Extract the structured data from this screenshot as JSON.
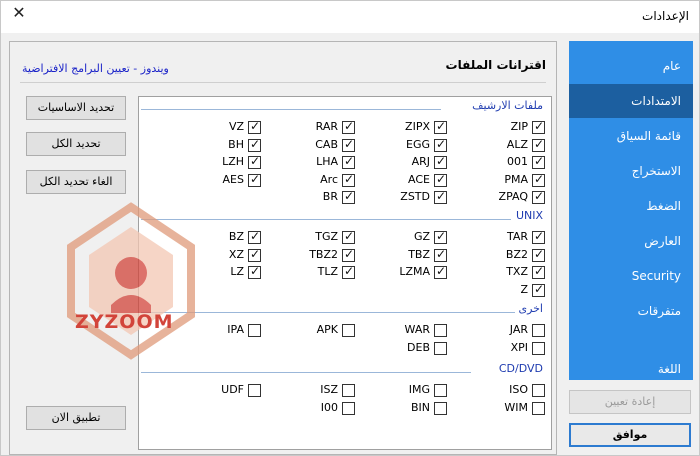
{
  "window": {
    "title": "الإعدادات",
    "close_glyph": "✕"
  },
  "sidebar": {
    "items": [
      {
        "label": "عام"
      },
      {
        "label": "الامتدادات",
        "active": true
      },
      {
        "label": "قائمة السياق"
      },
      {
        "label": "الاستخراج"
      },
      {
        "label": "الضغط"
      },
      {
        "label": "العارض"
      },
      {
        "label": "Security"
      },
      {
        "label": "متفرقات"
      },
      {
        "label": "اللغة"
      }
    ],
    "reset_label": "إعادة تعيين",
    "ok_label": "موافق"
  },
  "panel": {
    "heading": "اقترانات الملفات",
    "link": "ويندوز - تعيين البرامج الافتراضية",
    "buttons": {
      "select_basic": "تحديد الاساسيات",
      "select_all": "تحديد الكل",
      "deselect_all": "الغاء تحديد الكل",
      "apply_now": "تطبيق الان"
    }
  },
  "groups": [
    {
      "title": "ملفات الارشيف",
      "rows": [
        [
          "ZIP",
          "ZIPX",
          "RAR",
          "VZ"
        ],
        [
          "ALZ",
          "EGG",
          "CAB",
          "BH"
        ],
        [
          "001",
          "ARJ",
          "LHA",
          "LZH"
        ],
        [
          "PMA",
          "ACE",
          "Arc",
          "AES"
        ],
        [
          "ZPAQ",
          "ZSTD",
          "BR",
          ""
        ]
      ],
      "checked": [
        [
          true,
          true,
          true,
          true
        ],
        [
          true,
          true,
          true,
          true
        ],
        [
          true,
          true,
          true,
          true
        ],
        [
          true,
          true,
          true,
          true
        ],
        [
          true,
          true,
          true,
          false
        ]
      ]
    },
    {
      "title": "UNIX",
      "rows": [
        [
          "TAR",
          "GZ",
          "TGZ",
          "BZ"
        ],
        [
          "BZ2",
          "TBZ",
          "TBZ2",
          "XZ"
        ],
        [
          "TXZ",
          "LZMA",
          "TLZ",
          "LZ"
        ],
        [
          "Z",
          "",
          "",
          ""
        ]
      ],
      "checked": [
        [
          true,
          true,
          true,
          true
        ],
        [
          true,
          true,
          true,
          true
        ],
        [
          true,
          true,
          true,
          true
        ],
        [
          true,
          false,
          false,
          false
        ]
      ]
    },
    {
      "title": "اخرى",
      "rows": [
        [
          "JAR",
          "WAR",
          "APK",
          "IPA"
        ],
        [
          "XPI",
          "DEB",
          "",
          ""
        ]
      ],
      "checked": [
        [
          false,
          false,
          false,
          false
        ],
        [
          false,
          false,
          false,
          false
        ]
      ]
    },
    {
      "title": "CD/DVD",
      "rows": [
        [
          "ISO",
          "IMG",
          "ISZ",
          "UDF"
        ],
        [
          "WIM",
          "BIN",
          "I00",
          ""
        ]
      ],
      "checked": [
        [
          false,
          false,
          false,
          false
        ],
        [
          false,
          false,
          false,
          false
        ]
      ]
    }
  ],
  "watermark": {
    "text": "ZYZOOM",
    "color": "#d2443a"
  },
  "colors": {
    "sidebar": "#2f8ee6",
    "sidebar_active": "#1c5fa0",
    "link": "#1a22c8",
    "group_title": "#1f3cb0"
  }
}
